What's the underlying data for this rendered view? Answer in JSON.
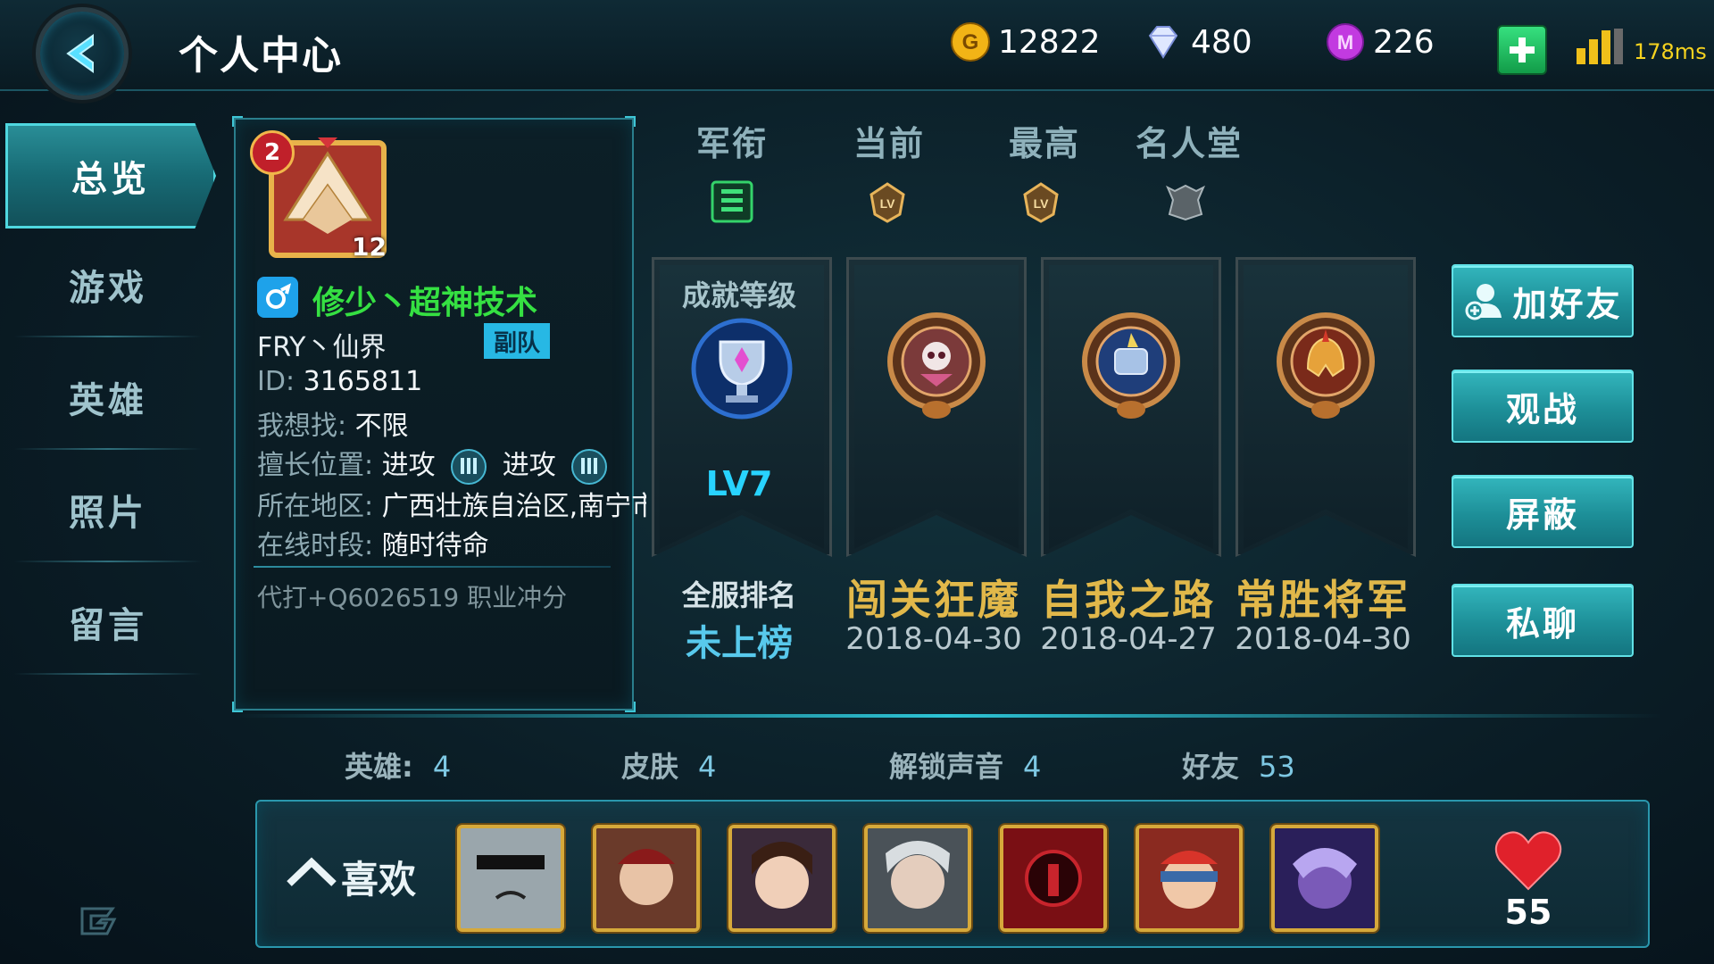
{
  "header": {
    "title": "个人中心",
    "gold": "12822",
    "diamond": "480",
    "gem": "226",
    "ping": "178ms"
  },
  "sidebar": {
    "items": [
      {
        "label": "总览",
        "active": true
      },
      {
        "label": "游戏"
      },
      {
        "label": "英雄"
      },
      {
        "label": "照片"
      },
      {
        "label": "留言"
      }
    ]
  },
  "profile": {
    "avatar_level": "2",
    "avatar_badge_number": "12",
    "name": "修少丶超神技术",
    "guild": "FRY丶仙界",
    "role": "副队",
    "id_label": "ID:",
    "id_value": "3165811",
    "seeking_label": "我想找:",
    "seeking_value": "不限",
    "position_label": "擅长位置:",
    "position_1": "进攻",
    "position_2": "进攻",
    "region_label": "所在地区:",
    "region_value": "广西壮族自治区,南宁市",
    "online_label": "在线时段:",
    "online_value": "随时待命",
    "signature": "代打+Q6026519 职业冲分"
  },
  "ranks": {
    "headers": [
      "军衔",
      "当前",
      "最高",
      "名人堂"
    ]
  },
  "achievements": {
    "level_title": "成就等级",
    "level_value": "LV7",
    "rank_label": "全服排名",
    "rank_value": "未上榜",
    "items": [
      {
        "title": "闯关狂魔",
        "date": "2018-04-30"
      },
      {
        "title": "自我之路",
        "date": "2018-04-27"
      },
      {
        "title": "常胜将军",
        "date": "2018-04-30"
      }
    ]
  },
  "actions": {
    "add_friend": "加好友",
    "spectate": "观战",
    "block": "屏蔽",
    "private_chat": "私聊"
  },
  "stats": {
    "heroes_label": "英雄:",
    "heroes_value": "4",
    "skins_label": "皮肤",
    "skins_value": "4",
    "voices_label": "解锁声音",
    "voices_value": "4",
    "friends_label": "好友",
    "friends_value": "53"
  },
  "likes": {
    "label": "喜欢",
    "count": "55"
  },
  "colors": {
    "accent": "#2dc4d6",
    "name_green": "#35e042",
    "title_gold": "#e1b84a",
    "button_teal": "#1d8f98"
  }
}
